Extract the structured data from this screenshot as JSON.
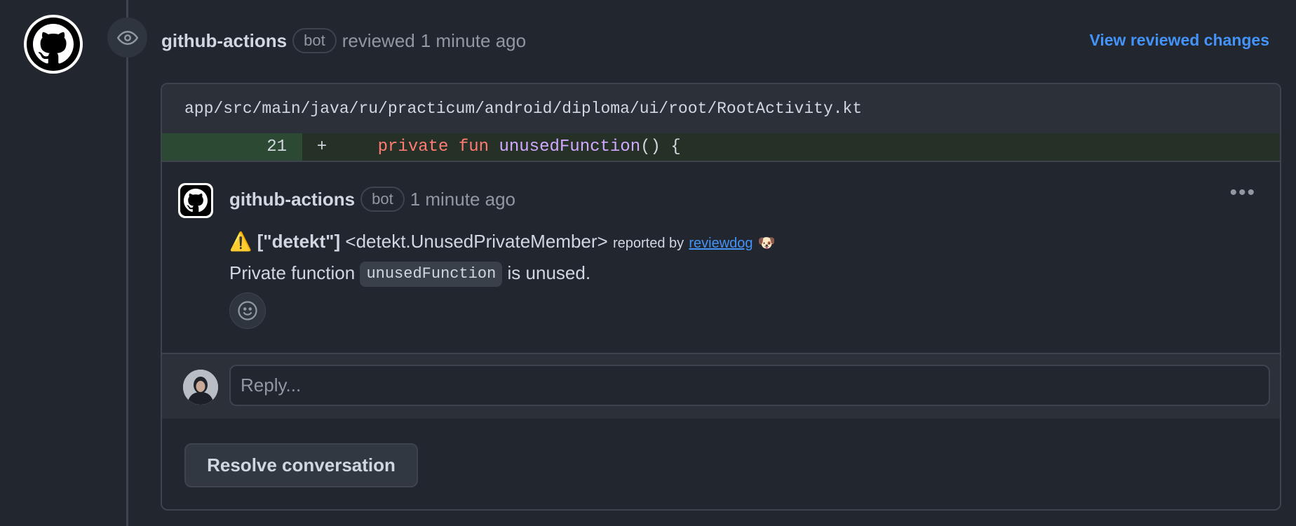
{
  "review": {
    "author": "github-actions",
    "badge": "bot",
    "action": "reviewed",
    "time": "1 minute ago",
    "view_link": "View reviewed changes"
  },
  "file": {
    "path": "app/src/main/java/ru/practicum/android/diploma/ui/root/RootActivity.kt",
    "line_number": "21",
    "sign": "+",
    "code_indent": "    ",
    "code_keyword1": "private",
    "code_keyword2": "fun",
    "code_function": "unusedFunction",
    "code_rest": "() {"
  },
  "comment": {
    "author": "github-actions",
    "badge": "bot",
    "time": "1 minute ago",
    "warning_emoji": "⚠️",
    "tag": "[\"detekt\"]",
    "rule": "<detekt.UnusedPrivateMember>",
    "reported_by": "reported by",
    "reporter_link": "reviewdog",
    "reporter_emoji": "🐶",
    "message_prefix": "Private function",
    "message_code": "unusedFunction",
    "message_suffix": "is unused.",
    "menu": "•••"
  },
  "reply": {
    "placeholder": "Reply..."
  },
  "resolve_label": "Resolve conversation",
  "icons": {
    "main_avatar": "github-icon",
    "event": "eye-icon",
    "reaction": "smiley-icon",
    "menu": "kebab-icon"
  },
  "colors": {
    "link": "#4493f8",
    "added_line": "#2c4a33",
    "keyword": "#ff7b72",
    "function": "#d2a8ff"
  }
}
